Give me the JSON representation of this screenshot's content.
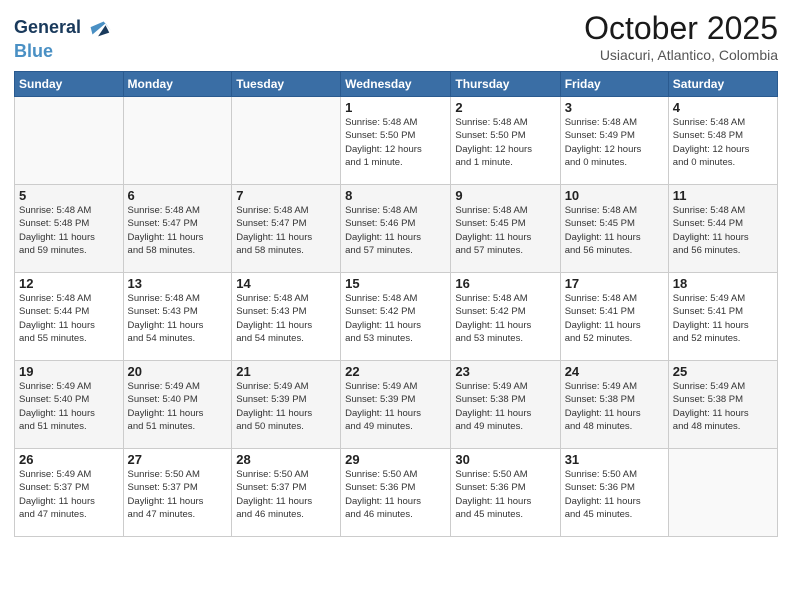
{
  "header": {
    "logo_line1": "General",
    "logo_line2": "Blue",
    "month": "October 2025",
    "location": "Usiacuri, Atlantico, Colombia"
  },
  "weekdays": [
    "Sunday",
    "Monday",
    "Tuesday",
    "Wednesday",
    "Thursday",
    "Friday",
    "Saturday"
  ],
  "weeks": [
    [
      {
        "day": "",
        "info": ""
      },
      {
        "day": "",
        "info": ""
      },
      {
        "day": "",
        "info": ""
      },
      {
        "day": "1",
        "info": "Sunrise: 5:48 AM\nSunset: 5:50 PM\nDaylight: 12 hours\nand 1 minute."
      },
      {
        "day": "2",
        "info": "Sunrise: 5:48 AM\nSunset: 5:50 PM\nDaylight: 12 hours\nand 1 minute."
      },
      {
        "day": "3",
        "info": "Sunrise: 5:48 AM\nSunset: 5:49 PM\nDaylight: 12 hours\nand 0 minutes."
      },
      {
        "day": "4",
        "info": "Sunrise: 5:48 AM\nSunset: 5:48 PM\nDaylight: 12 hours\nand 0 minutes."
      }
    ],
    [
      {
        "day": "5",
        "info": "Sunrise: 5:48 AM\nSunset: 5:48 PM\nDaylight: 11 hours\nand 59 minutes."
      },
      {
        "day": "6",
        "info": "Sunrise: 5:48 AM\nSunset: 5:47 PM\nDaylight: 11 hours\nand 58 minutes."
      },
      {
        "day": "7",
        "info": "Sunrise: 5:48 AM\nSunset: 5:47 PM\nDaylight: 11 hours\nand 58 minutes."
      },
      {
        "day": "8",
        "info": "Sunrise: 5:48 AM\nSunset: 5:46 PM\nDaylight: 11 hours\nand 57 minutes."
      },
      {
        "day": "9",
        "info": "Sunrise: 5:48 AM\nSunset: 5:45 PM\nDaylight: 11 hours\nand 57 minutes."
      },
      {
        "day": "10",
        "info": "Sunrise: 5:48 AM\nSunset: 5:45 PM\nDaylight: 11 hours\nand 56 minutes."
      },
      {
        "day": "11",
        "info": "Sunrise: 5:48 AM\nSunset: 5:44 PM\nDaylight: 11 hours\nand 56 minutes."
      }
    ],
    [
      {
        "day": "12",
        "info": "Sunrise: 5:48 AM\nSunset: 5:44 PM\nDaylight: 11 hours\nand 55 minutes."
      },
      {
        "day": "13",
        "info": "Sunrise: 5:48 AM\nSunset: 5:43 PM\nDaylight: 11 hours\nand 54 minutes."
      },
      {
        "day": "14",
        "info": "Sunrise: 5:48 AM\nSunset: 5:43 PM\nDaylight: 11 hours\nand 54 minutes."
      },
      {
        "day": "15",
        "info": "Sunrise: 5:48 AM\nSunset: 5:42 PM\nDaylight: 11 hours\nand 53 minutes."
      },
      {
        "day": "16",
        "info": "Sunrise: 5:48 AM\nSunset: 5:42 PM\nDaylight: 11 hours\nand 53 minutes."
      },
      {
        "day": "17",
        "info": "Sunrise: 5:48 AM\nSunset: 5:41 PM\nDaylight: 11 hours\nand 52 minutes."
      },
      {
        "day": "18",
        "info": "Sunrise: 5:49 AM\nSunset: 5:41 PM\nDaylight: 11 hours\nand 52 minutes."
      }
    ],
    [
      {
        "day": "19",
        "info": "Sunrise: 5:49 AM\nSunset: 5:40 PM\nDaylight: 11 hours\nand 51 minutes."
      },
      {
        "day": "20",
        "info": "Sunrise: 5:49 AM\nSunset: 5:40 PM\nDaylight: 11 hours\nand 51 minutes."
      },
      {
        "day": "21",
        "info": "Sunrise: 5:49 AM\nSunset: 5:39 PM\nDaylight: 11 hours\nand 50 minutes."
      },
      {
        "day": "22",
        "info": "Sunrise: 5:49 AM\nSunset: 5:39 PM\nDaylight: 11 hours\nand 49 minutes."
      },
      {
        "day": "23",
        "info": "Sunrise: 5:49 AM\nSunset: 5:38 PM\nDaylight: 11 hours\nand 49 minutes."
      },
      {
        "day": "24",
        "info": "Sunrise: 5:49 AM\nSunset: 5:38 PM\nDaylight: 11 hours\nand 48 minutes."
      },
      {
        "day": "25",
        "info": "Sunrise: 5:49 AM\nSunset: 5:38 PM\nDaylight: 11 hours\nand 48 minutes."
      }
    ],
    [
      {
        "day": "26",
        "info": "Sunrise: 5:49 AM\nSunset: 5:37 PM\nDaylight: 11 hours\nand 47 minutes."
      },
      {
        "day": "27",
        "info": "Sunrise: 5:50 AM\nSunset: 5:37 PM\nDaylight: 11 hours\nand 47 minutes."
      },
      {
        "day": "28",
        "info": "Sunrise: 5:50 AM\nSunset: 5:37 PM\nDaylight: 11 hours\nand 46 minutes."
      },
      {
        "day": "29",
        "info": "Sunrise: 5:50 AM\nSunset: 5:36 PM\nDaylight: 11 hours\nand 46 minutes."
      },
      {
        "day": "30",
        "info": "Sunrise: 5:50 AM\nSunset: 5:36 PM\nDaylight: 11 hours\nand 45 minutes."
      },
      {
        "day": "31",
        "info": "Sunrise: 5:50 AM\nSunset: 5:36 PM\nDaylight: 11 hours\nand 45 minutes."
      },
      {
        "day": "",
        "info": ""
      }
    ]
  ]
}
